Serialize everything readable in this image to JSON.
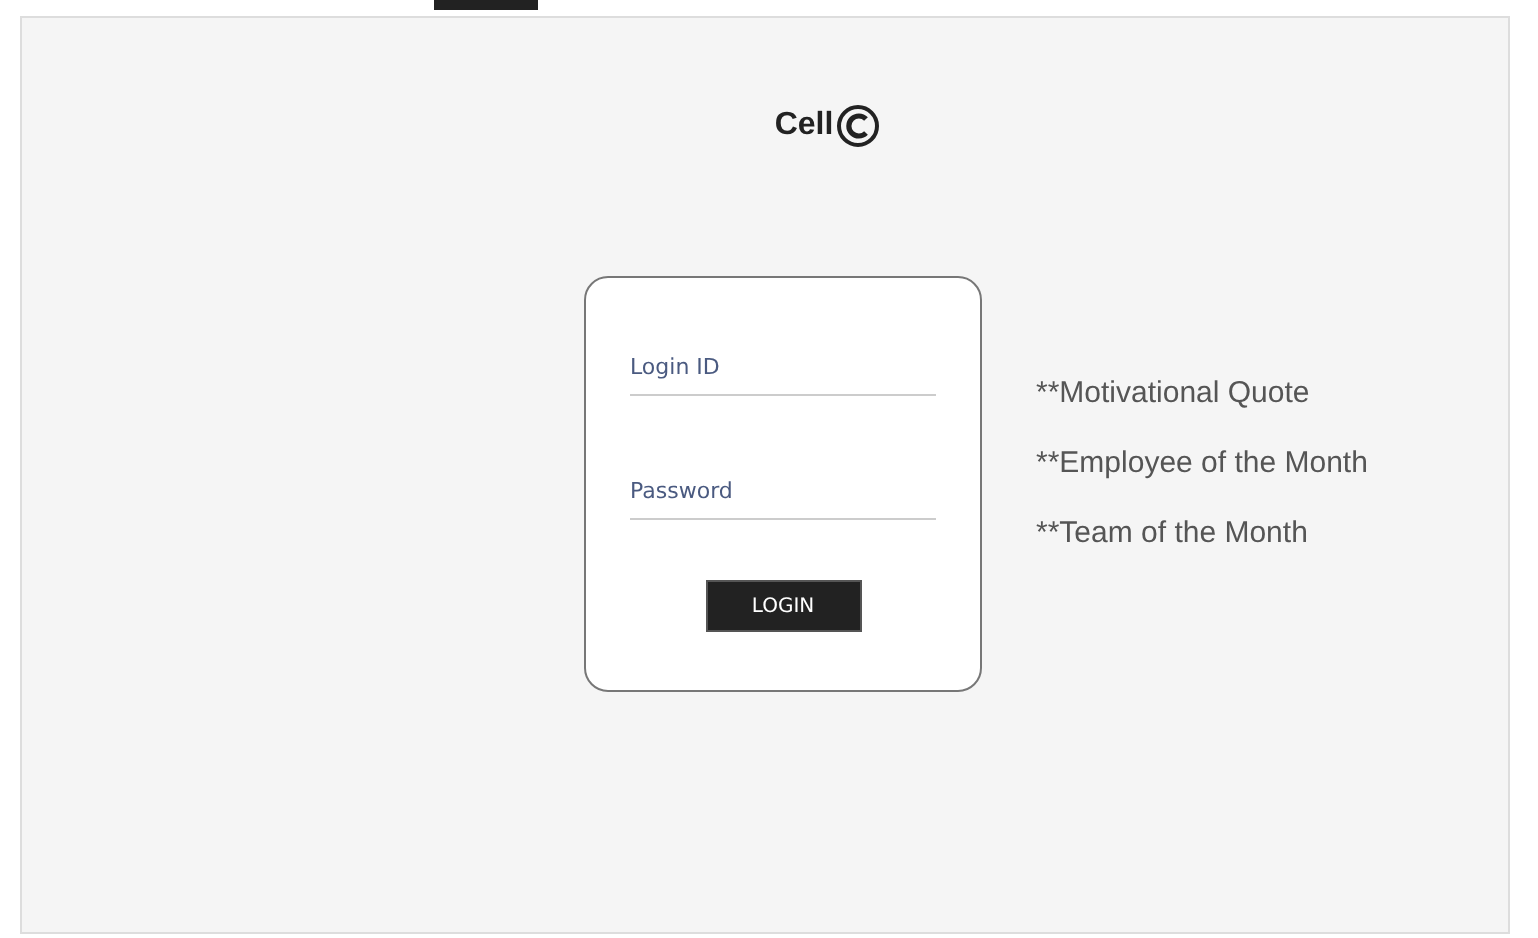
{
  "logo": {
    "text": "Cell"
  },
  "login_form": {
    "fields": [
      {
        "placeholder": "Login ID"
      },
      {
        "placeholder": "Password"
      }
    ],
    "button": "LOGIN"
  },
  "highlights": [
    "**Motivational Quote",
    "**Employee of the Month",
    "**Team of the Month"
  ]
}
